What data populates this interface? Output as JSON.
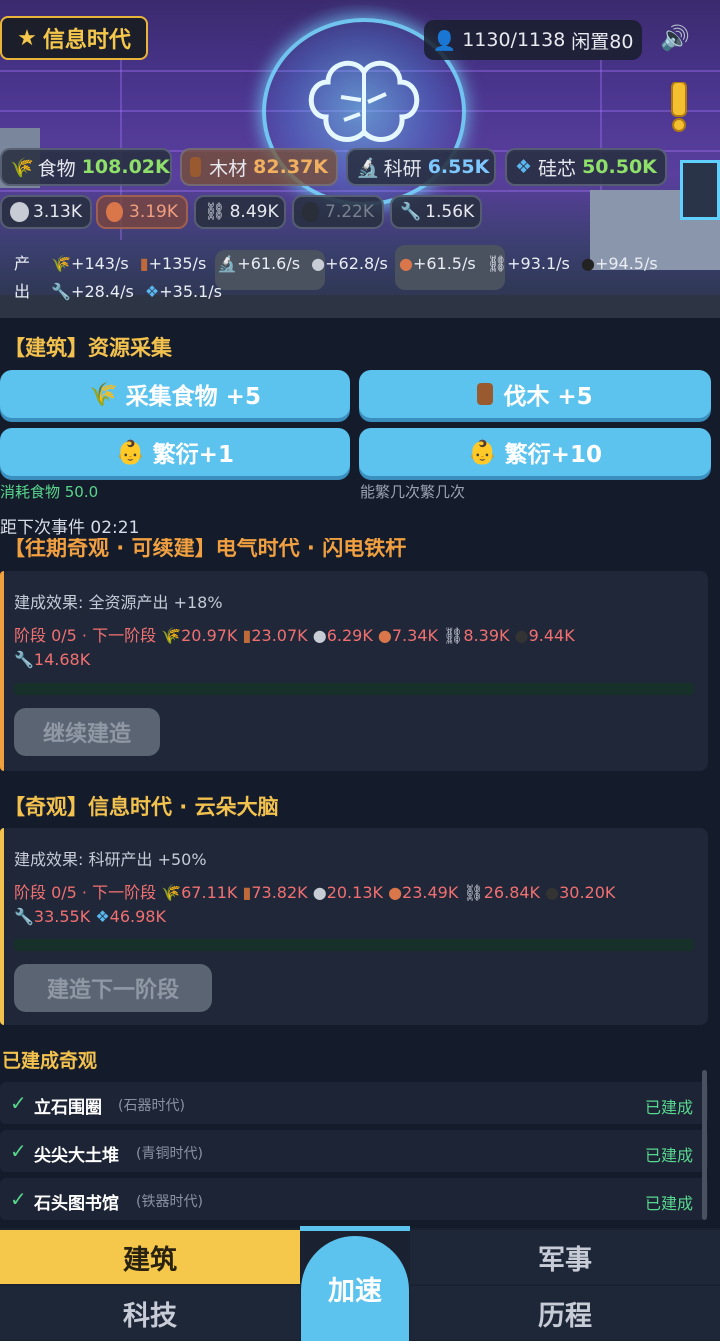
{
  "header": {
    "era_title": "信息时代",
    "population": "1130/1138",
    "idle": "闲置80",
    "resources_row1": [
      {
        "icon": "wheat-icon",
        "label": "食物",
        "value": "108.02K",
        "color": "#8ee06a"
      },
      {
        "icon": "wood-log-icon",
        "label": "木材",
        "value": "82.37K",
        "color": "#f0b060"
      },
      {
        "icon": "microscope-icon",
        "label": "科研",
        "value": "6.55K",
        "color": "#7fc8ff"
      },
      {
        "icon": "chip-icon",
        "label": "硅芯",
        "value": "50.50K",
        "color": "#8ee06a"
      }
    ],
    "resources_row2": [
      {
        "icon": "stone-icon",
        "value": "3.13K"
      },
      {
        "icon": "copper-icon",
        "value": "3.19K"
      },
      {
        "icon": "chain-icon",
        "value": "8.49K"
      },
      {
        "icon": "coal-icon",
        "value": "7.22K"
      },
      {
        "icon": "tool-icon",
        "value": "1.56K"
      }
    ],
    "output_label_1": "产",
    "output_label_2": "出",
    "rates_row1": [
      "+143/s",
      "+135/s",
      "+61.6/s",
      "+62.8/s",
      "+61.5/s",
      "+93.1/s",
      "+94.5/s"
    ],
    "rates_row2": [
      "+28.4/s",
      "+35.1/s"
    ]
  },
  "gather": {
    "title": "【建筑】资源采集",
    "btn_food": "采集食物 +5",
    "btn_wood": "伐木 +5",
    "btn_breed1": "繁衍+1",
    "btn_breed10": "繁衍+10",
    "cost_note": "消耗食物 50.0",
    "breed_note": "能繁几次繁几次",
    "next_event": "距下次事件 02:21"
  },
  "wonder1": {
    "title": "【往期奇观 · 可续建】电气时代 · 闪电铁杆",
    "effect": "建成效果: 全资源产出 +18%",
    "stage": "阶段 0/5 · 下一阶段",
    "costs_line1": [
      "20.97K",
      "23.07K",
      "6.29K",
      "7.34K",
      "8.39K",
      "9.44K"
    ],
    "costs_line2": [
      "14.68K"
    ],
    "button": "继续建造"
  },
  "wonder2": {
    "title": "【奇观】信息时代 · 云朵大脑",
    "effect": "建成效果: 科研产出 +50%",
    "stage": "阶段 0/5 · 下一阶段",
    "costs_line1": [
      "67.11K",
      "73.82K",
      "20.13K",
      "23.49K",
      "26.84K",
      "30.20K"
    ],
    "costs_line2": [
      "33.55K",
      "46.98K"
    ],
    "button": "建造下一阶段"
  },
  "built": {
    "title": "已建成奇观",
    "items": [
      {
        "name": "立石围圈",
        "era": "(石器时代)",
        "status": "已建成"
      },
      {
        "name": "尖尖大土堆",
        "era": "(青铜时代)",
        "status": "已建成"
      },
      {
        "name": "石头图书馆",
        "era": "(铁器时代)",
        "status": "已建成"
      }
    ]
  },
  "nav": {
    "build": "建筑",
    "military": "军事",
    "tech": "科技",
    "history": "历程",
    "speed": "加速"
  },
  "colors": {
    "gold": "#f2c14e",
    "blue_button": "#5cc3ee",
    "cost_red": "#f07070",
    "built_green": "#58d68d"
  }
}
